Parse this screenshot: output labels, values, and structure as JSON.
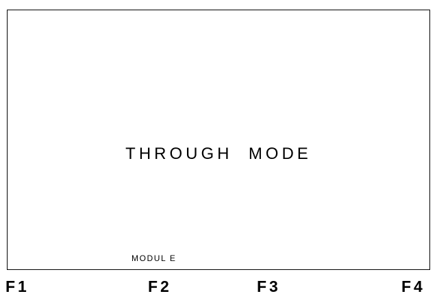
{
  "display": {
    "mode_text": "THROUGH  MODE",
    "softkey_labels": {
      "f1": "",
      "f2": "MODUL E",
      "f3": "",
      "f4": ""
    }
  },
  "function_keys": [
    "F1",
    "F2",
    "F3",
    "F4"
  ]
}
